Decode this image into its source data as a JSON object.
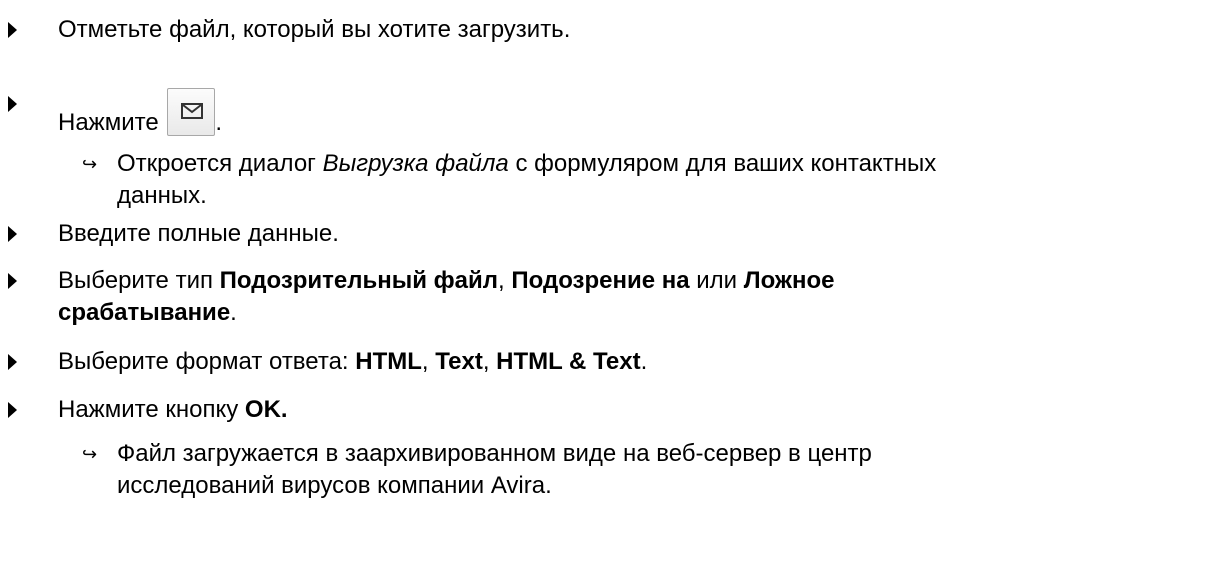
{
  "steps": [
    {
      "text": "Отметьте файл, который вы хотите загрузить."
    },
    {
      "before": "Нажмите",
      "after": ".",
      "icon": "mail-envelope-icon"
    },
    {
      "result_before": "Откроется диалог ",
      "result_italic": "Выгрузка файла",
      "result_after": " с формуляром для ваших контактных",
      "result_line2": "данных.",
      "result_marker": "↪"
    },
    {
      "text": "Введите полные данные."
    },
    {
      "before": "Выберите тип ",
      "bold1": "Подозрительный файл",
      "mid1": ", ",
      "bold2": "Подозрение на",
      "mid2": " или ",
      "bold3": "Ложное",
      "line2_bold": "срабатывание",
      "line2_after": "."
    },
    {
      "before": "Выберите формат ответа: ",
      "bold1": "HTML",
      "sep1": ", ",
      "bold2": "Text",
      "sep2": ", ",
      "bold3": "HTML & Text",
      "after": "."
    },
    {
      "before": "Нажмите кнопку ",
      "bold": "OK."
    },
    {
      "result_line1": "Файл загружается в заархивированном виде на веб-сервер в центр",
      "result_line2": "исследований вирусов компании Avira.",
      "result_marker": "↪"
    }
  ]
}
